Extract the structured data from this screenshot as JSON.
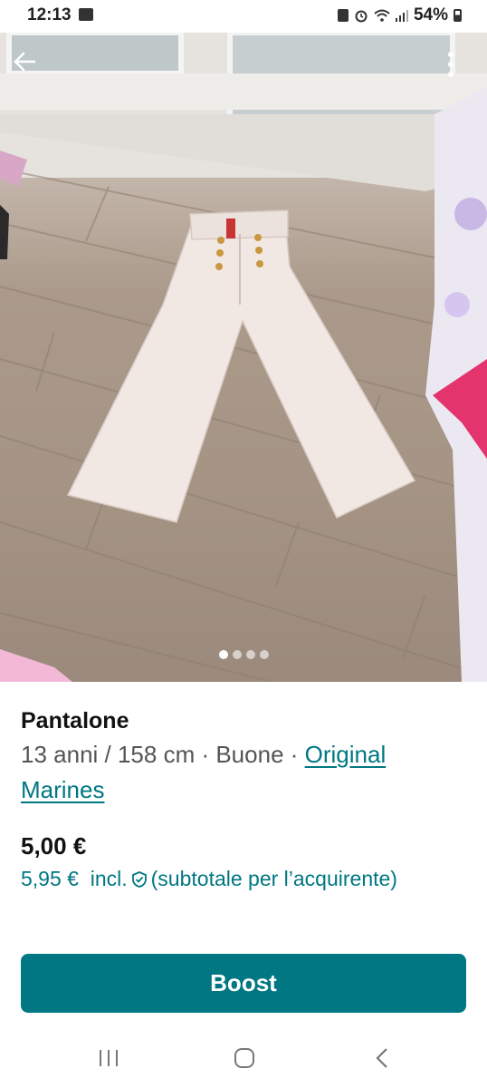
{
  "status_bar": {
    "time": "12:13",
    "battery": "54%"
  },
  "gallery": {
    "image_alt": "white wide-leg trousers laid on a wooden floor",
    "page_count": 4,
    "active_index": 0
  },
  "item": {
    "title": "Pantalone",
    "size": "13 anni / 158 cm",
    "separator1": " · ",
    "condition": "Buone",
    "separator2": " · ",
    "brand": "Original Marines",
    "price": "5,00 €",
    "price_with_fee": "5,95 €",
    "incl_label": "incl.",
    "subtotal_note": "(subtotale per l’acquirente)"
  },
  "actions": {
    "boost_label": "Boost"
  },
  "icons": {
    "back": "arrow-left-icon",
    "more": "more-vertical-icon",
    "shield": "shield-check-icon",
    "nav_recent": "recent-apps-icon",
    "nav_home": "home-icon",
    "nav_back": "chevron-left-icon"
  },
  "colors": {
    "accent": "#007782",
    "text": "#111111",
    "muted": "#555555"
  }
}
